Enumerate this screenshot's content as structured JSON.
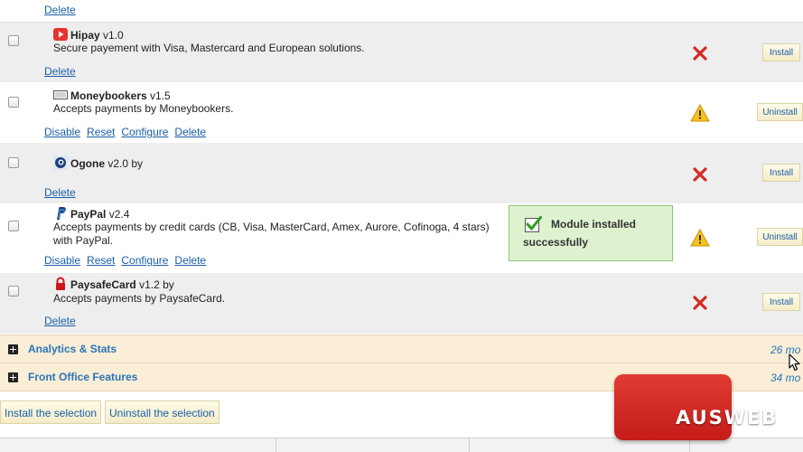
{
  "modules": [
    {
      "id": "top",
      "links": [
        "Delete"
      ]
    },
    {
      "id": "hipay",
      "name": "Hipay",
      "version": "v1.0",
      "description": [
        "Secure payement with Visa, Mastercard and European solutions."
      ],
      "links": [
        "Delete"
      ],
      "status": "not-installed",
      "status_icon": "red-x-icon",
      "button": "Install"
    },
    {
      "id": "moneybookers",
      "name": "Moneybookers",
      "version": "v1.5",
      "description": [
        "Accepts payments by Moneybookers."
      ],
      "links": [
        "Disable",
        "Reset",
        "Configure",
        "Delete"
      ],
      "status": "warning",
      "status_icon": "warning-triangle-icon",
      "button": "Uninstall"
    },
    {
      "id": "ogone",
      "name": "Ogone",
      "version": "v2.0 by",
      "description": [],
      "links": [
        "Delete"
      ],
      "status": "not-installed",
      "status_icon": "red-x-icon",
      "button": "Install"
    },
    {
      "id": "paypal",
      "name": "PayPal",
      "version": "v2.4",
      "description": [
        "Accepts payments by credit cards (CB, Visa, MasterCard, Amex, Aurore, Cofinoga, 4 stars)",
        "with PayPal."
      ],
      "links": [
        "Disable",
        "Reset",
        "Configure",
        "Delete"
      ],
      "status": "warning",
      "status_icon": "warning-triangle-icon",
      "button": "Uninstall"
    },
    {
      "id": "paysafecard",
      "name": "PaysafeCard",
      "version": "v1.2 by",
      "description": [
        "Accepts payments by PaysafeCard."
      ],
      "links": [
        "Delete"
      ],
      "status": "not-installed",
      "status_icon": "red-x-icon",
      "button": "Install"
    }
  ],
  "notice": {
    "line1": "Module installed",
    "line2": "successfully",
    "icon": "green-check-icon"
  },
  "categories": [
    {
      "label": "Analytics & Stats",
      "count": "26 mo"
    },
    {
      "label": "Front Office Features",
      "count": "34 mo"
    }
  ],
  "actions": {
    "install_selection": "Install the selection",
    "uninstall_selection": "Uninstall the selection"
  },
  "watermark": {
    "text": "AUSWEB",
    "color": "#d42a24"
  },
  "colors": {
    "link": "#1a5fa8",
    "category_bg": "#fbeed6",
    "notice_bg": "#dff2cf",
    "error": "#d42a24",
    "warning": "#f2b600"
  }
}
